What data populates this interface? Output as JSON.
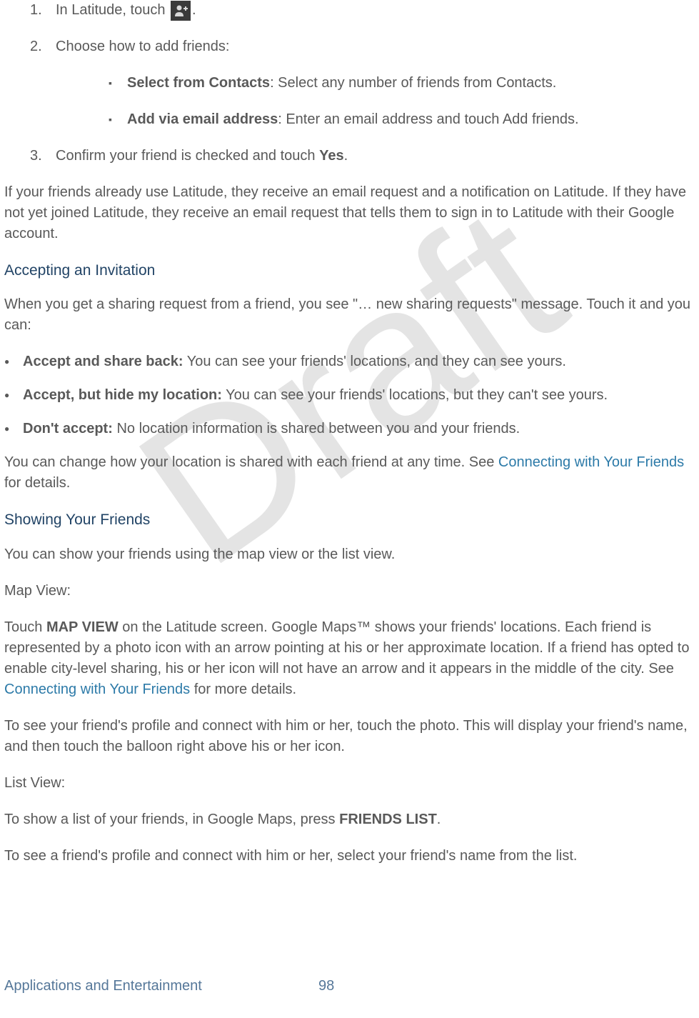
{
  "watermark": "Draft",
  "steps": {
    "item1": {
      "num": "1.",
      "text_a": "In Latitude, touch ",
      "text_b": "."
    },
    "item2": {
      "num": "2.",
      "text": "Choose how to add friends:",
      "sub": [
        {
          "bold": "Select from Contacts",
          "rest": ": Select any number of friends from Contacts."
        },
        {
          "bold": "Add via email address",
          "rest": ": Enter an email address and touch Add friends."
        }
      ]
    },
    "item3": {
      "num": "3.",
      "text_a": "Confirm your friend is checked and touch ",
      "bold": "Yes",
      "text_b": "."
    }
  },
  "para_existing": "If your friends already use Latitude, they receive an email request and a notification on Latitude. If they have not yet joined Latitude, they receive an email request that tells them to sign in to Latitude with their Google account.",
  "heading_accepting": "Accepting an Invitation",
  "para_accepting": "When you get a sharing request from a friend, you see \"… new sharing requests\" message. Touch it and you can:",
  "accept_options": [
    {
      "bold": "Accept and share back:",
      "rest": " You can see your friends' locations, and they can see yours."
    },
    {
      "bold": "Accept, but hide my location:",
      "rest": " You can see your friends' locations, but they can't see yours."
    },
    {
      "bold": "Don't accept:",
      "rest": " No location information is shared between you and your friends."
    }
  ],
  "para_change_a": "You can change how your location is shared with each friend at any time. See ",
  "link_connecting1": "Connecting with Your Friends",
  "para_change_b": " for details.",
  "heading_showing": "Showing Your Friends",
  "para_showing": "You can show your friends using the map view or the list view.",
  "mapview_label": "Map View:",
  "para_mapview_a": "Touch ",
  "para_mapview_bold": "MAP VIEW",
  "para_mapview_b": " on the Latitude screen. Google Maps™ shows your friends' locations. Each friend is represented by a photo icon with an arrow pointing at his or her approximate location. If a friend has opted to enable city-level sharing, his or her icon will not have an arrow and it appears in the middle of the city. See ",
  "link_connecting2": "Connecting with Your Friends",
  "para_mapview_c": " for more details.",
  "para_mapview_profile": "To see your friend's profile and connect with him or her, touch the photo. This will display your friend's name, and then touch the balloon right above his or her icon.",
  "listview_label": "List View:",
  "para_listview_a": "To show a list of your friends, in Google Maps, press ",
  "para_listview_bold": "FRIENDS LIST",
  "para_listview_b": ".",
  "para_listview_profile": "To see a friend's profile and connect with him or her, select your friend's name from the list.",
  "footer": {
    "section": "Applications and Entertainment",
    "page": "98"
  }
}
